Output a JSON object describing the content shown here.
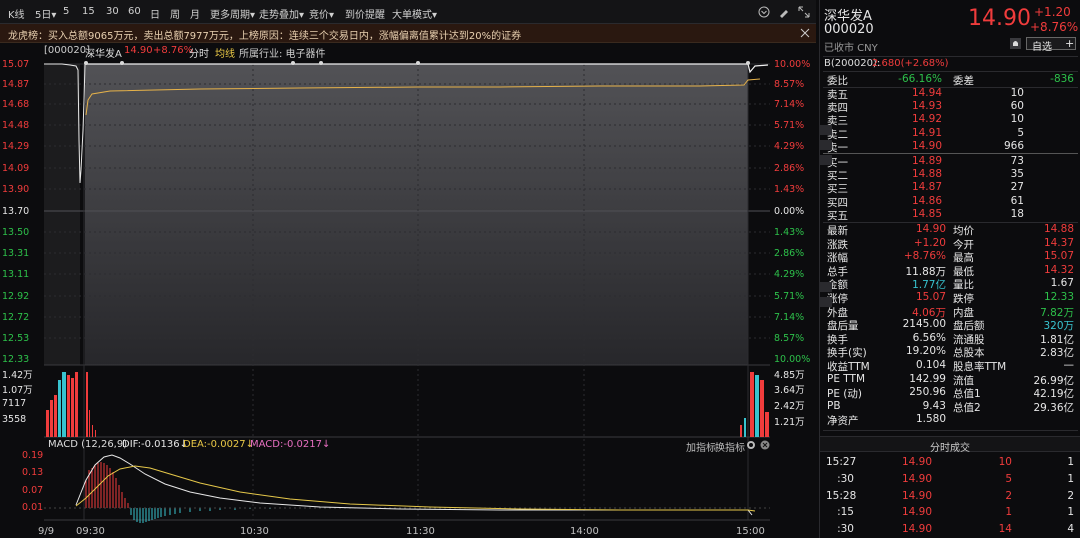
{
  "toolbar": {
    "kline": "K线",
    "d5": "5日",
    "d5_arrow": "▾",
    "m5": "5",
    "m15": "15",
    "m30": "30",
    "m60": "60",
    "day": "日",
    "week": "周",
    "month": "月",
    "more_period": "更多周期",
    "more_period_arrow": "▾",
    "overlay": "走势叠加",
    "overlay_arrow": "▾",
    "auction": "竞价",
    "auction_arrow": "▾",
    "alert": "到价提醒",
    "bigorder": "大单模式",
    "bigorder_arrow": "▾"
  },
  "notice": {
    "text": "龙虎榜：买入总额9065万元，卖出总额7977万元，上榜原因：连续三个交易日内，涨幅偏离值累计达到20%的证券"
  },
  "chart_header": {
    "code": "[000020]",
    "name": "深华发A",
    "price": "14.90",
    "change": "+8.76%",
    "tab_fenshi": "分时",
    "tab_junxian": "均线",
    "industry": "所属行业: 电子器件"
  },
  "price_axis_left": [
    "15.07",
    "14.87",
    "14.68",
    "14.48",
    "14.29",
    "14.09",
    "13.90",
    "13.70",
    "13.50",
    "13.31",
    "13.11",
    "12.92",
    "12.72",
    "12.53",
    "12.33"
  ],
  "price_axis_right": [
    "10.00%",
    "8.57%",
    "7.14%",
    "5.71%",
    "4.29%",
    "2.86%",
    "1.43%",
    "0.00%",
    "1.43%",
    "2.86%",
    "4.29%",
    "5.71%",
    "7.14%",
    "8.57%",
    "10.00%"
  ],
  "vol_axis_left": [
    "1.42万",
    "1.07万",
    "7117",
    "3558"
  ],
  "vol_axis_right": [
    "4.85万",
    "3.64万",
    "2.42万",
    "1.21万"
  ],
  "macd": {
    "title": "MACD (12,26,9)",
    "dif": "DIF:-0.0136",
    "dif_arrow": "↓",
    "dea": "DEA:-0.0027",
    "dea_arrow": "↓",
    "macd": "MACD:-0.0217",
    "macd_arrow": "↓",
    "add_indicator": "加指标",
    "switch_indicator": "换指标",
    "axis": [
      "0.19",
      "0.13",
      "0.07",
      "0.01"
    ]
  },
  "time_axis": [
    "9/9",
    "09:30",
    "10:30",
    "11:30",
    "14:00",
    "15:00"
  ],
  "quote": {
    "name": "深华发A",
    "code": "000020",
    "price": "14.90",
    "change": "+1.20",
    "pct": "+8.76%",
    "status": "已收市 CNY",
    "selfselect": "自选",
    "plus": "+",
    "b_code": "B(200020):",
    "b_val": "2.680(+2.68%)",
    "weibi_label": "委比",
    "weibi": "-66.16%",
    "weicha_label": "委差",
    "weicha": "-836",
    "asks": [
      {
        "label": "卖五",
        "price": "14.94",
        "vol": "10"
      },
      {
        "label": "卖四",
        "price": "14.93",
        "vol": "60"
      },
      {
        "label": "卖三",
        "price": "14.92",
        "vol": "10"
      },
      {
        "label": "卖二",
        "price": "14.91",
        "vol": "5"
      },
      {
        "label": "卖一",
        "price": "14.90",
        "vol": "966"
      }
    ],
    "bids": [
      {
        "label": "买一",
        "price": "14.89",
        "vol": "73"
      },
      {
        "label": "买二",
        "price": "14.88",
        "vol": "35"
      },
      {
        "label": "买三",
        "price": "14.87",
        "vol": "27"
      },
      {
        "label": "买四",
        "price": "14.86",
        "vol": "61"
      },
      {
        "label": "买五",
        "price": "14.85",
        "vol": "18"
      }
    ],
    "stats": [
      {
        "l1": "最新",
        "v1": "14.90",
        "c1": "red",
        "l2": "均价",
        "v2": "14.88",
        "c2": "red"
      },
      {
        "l1": "涨跌",
        "v1": "+1.20",
        "c1": "red",
        "l2": "今开",
        "v2": "14.37",
        "c2": "red"
      },
      {
        "l1": "涨幅",
        "v1": "+8.76%",
        "c1": "red",
        "l2": "最高",
        "v2": "15.07",
        "c2": "red"
      },
      {
        "l1": "总手",
        "v1": "11.88万",
        "c1": "wht",
        "l2": "最低",
        "v2": "14.32",
        "c2": "red"
      },
      {
        "l1": "金额",
        "v1": "1.77亿",
        "c1": "cyan",
        "l2": "量比",
        "v2": "1.67",
        "c2": "wht"
      },
      {
        "l1": "涨停",
        "v1": "15.07",
        "c1": "red",
        "l2": "跌停",
        "v2": "12.33",
        "c2": "green"
      },
      {
        "l1": "外盘",
        "v1": "4.06万",
        "c1": "red",
        "l2": "内盘",
        "v2": "7.82万",
        "c2": "green"
      },
      {
        "l1": "盘后量",
        "v1": "2145.00",
        "c1": "wht",
        "l2": "盘后额",
        "v2": "320万",
        "c2": "cyan"
      },
      {
        "l1": "换手",
        "v1": "6.56%",
        "c1": "wht",
        "l2": "流通股",
        "v2": "1.81亿",
        "c2": "wht"
      },
      {
        "l1": "换手(实)",
        "v1": "19.20%",
        "c1": "wht",
        "l2": "总股本",
        "v2": "2.83亿",
        "c2": "wht"
      },
      {
        "l1": "收益TTM",
        "v1": "0.104",
        "c1": "wht",
        "l2": "股息率TTM",
        "v2": "—",
        "c2": "wht"
      },
      {
        "l1": "PE TTM",
        "v1": "142.99",
        "c1": "wht",
        "l2": "流值",
        "v2": "26.99亿",
        "c2": "wht"
      },
      {
        "l1": "PE (动)",
        "v1": "250.96",
        "c1": "wht",
        "l2": "总值1",
        "v2": "42.19亿",
        "c2": "wht"
      },
      {
        "l1": "PB",
        "v1": "9.43",
        "c1": "wht",
        "l2": "总值2",
        "v2": "29.36亿",
        "c2": "wht"
      },
      {
        "l1": "净资产",
        "v1": "1.580",
        "c1": "wht",
        "l2": "",
        "v2": "",
        "c2": "wht"
      }
    ]
  },
  "ticks_title": "分时成交",
  "ticks": [
    {
      "time": "15:27",
      "price": "14.90",
      "vol": "10",
      "n": "1"
    },
    {
      "time": ":30",
      "price": "14.90",
      "vol": "5",
      "n": "1"
    },
    {
      "time": "15:28",
      "price": "14.90",
      "vol": "2",
      "n": "2"
    },
    {
      "time": ":15",
      "price": "14.90",
      "vol": "1",
      "n": "1"
    },
    {
      "time": ":30",
      "price": "14.90",
      "vol": "14",
      "n": "4"
    }
  ],
  "chart_data": {
    "type": "line",
    "title": "深华发A 分时",
    "series": [
      {
        "name": "分时",
        "values": [
          13.7,
          13.8,
          14.6,
          14.85,
          14.9,
          14.9,
          14.9,
          14.9,
          14.9,
          14.9,
          14.9,
          14.9,
          14.9,
          14.9,
          14.9,
          14.9,
          14.85,
          14.9
        ]
      },
      {
        "name": "均线",
        "values": [
          13.7,
          14.6,
          14.75,
          14.78,
          14.8,
          14.82,
          14.83,
          14.84,
          14.85,
          14.85,
          14.86,
          14.86,
          14.86,
          14.87,
          14.87,
          14.87,
          14.88,
          14.88
        ]
      }
    ],
    "ylim": [
      12.33,
      15.07
    ],
    "x": [
      "09:30",
      "10:30",
      "11:30",
      "14:00",
      "15:00"
    ]
  }
}
